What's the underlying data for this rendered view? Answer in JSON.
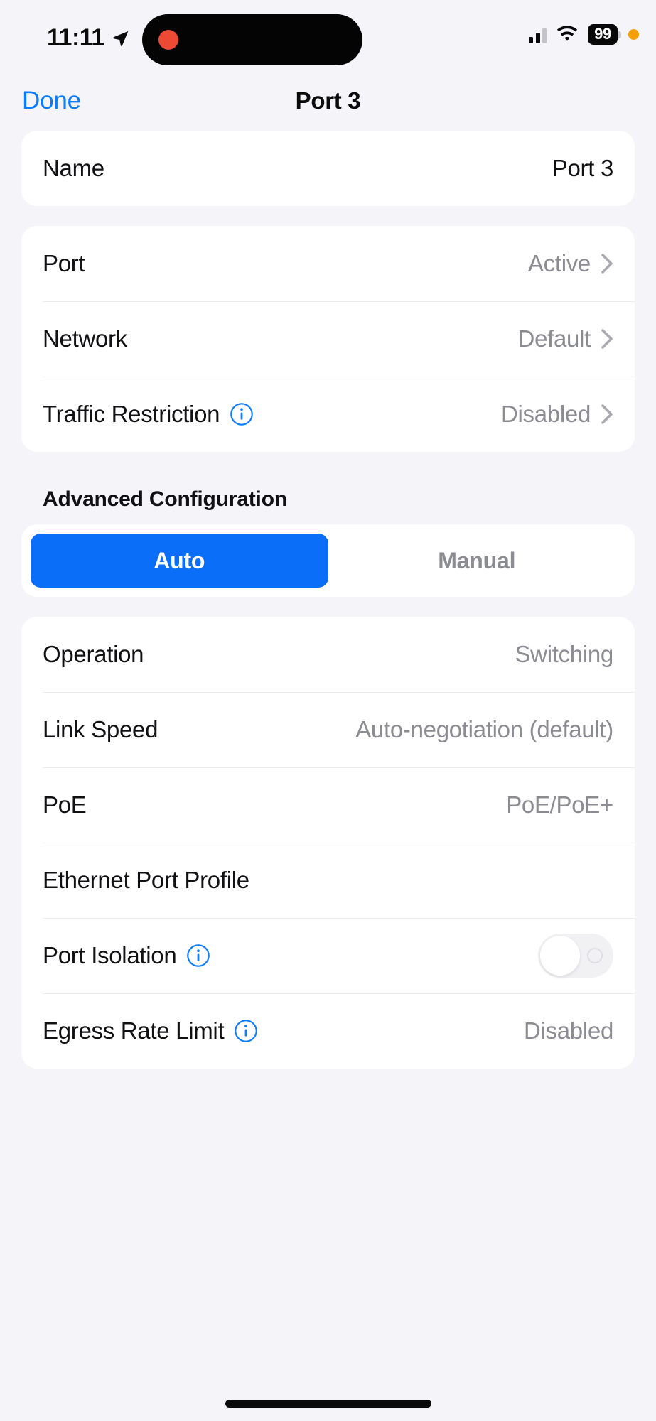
{
  "statusbar": {
    "time": "11:11",
    "location_icon": "location-arrow-icon",
    "signal_icon": "cellular-signal-icon",
    "wifi_icon": "wifi-icon",
    "battery_level": "99",
    "recording_dot": "recording-indicator",
    "privacy_dot": "privacy-indicator"
  },
  "navbar": {
    "done_label": "Done",
    "title": "Port 3"
  },
  "name_section": {
    "label": "Name",
    "value": "Port 3"
  },
  "port_section": {
    "rows": [
      {
        "label": "Port",
        "value": "Active",
        "chevron": true,
        "info": false
      },
      {
        "label": "Network",
        "value": "Default",
        "chevron": true,
        "info": false
      },
      {
        "label": "Traffic Restriction",
        "value": "Disabled",
        "chevron": true,
        "info": true
      }
    ]
  },
  "advanced": {
    "header": "Advanced Configuration",
    "segments": [
      {
        "label": "Auto",
        "selected": true
      },
      {
        "label": "Manual",
        "selected": false
      }
    ]
  },
  "advanced_rows": [
    {
      "label": "Operation",
      "value": "Switching",
      "info": false,
      "toggle": false
    },
    {
      "label": "Link Speed",
      "value": "Auto-negotiation (default)",
      "info": false,
      "toggle": false
    },
    {
      "label": "PoE",
      "value": "PoE/PoE+",
      "info": false,
      "toggle": false
    },
    {
      "label": "Ethernet Port Profile",
      "value": "",
      "info": false,
      "toggle": false
    },
    {
      "label": "Port Isolation",
      "value": "",
      "info": true,
      "toggle": true,
      "toggle_on": false
    },
    {
      "label": "Egress Rate Limit",
      "value": "Disabled",
      "info": true,
      "toggle": false
    }
  ],
  "colors": {
    "accent_blue": "#0B6EF8",
    "link_blue": "#0A7CFF",
    "page_bg": "#F5F4F8",
    "card_bg": "#FFFFFF",
    "value_gray": "#8B8B92",
    "privacy_orange": "#F5A000",
    "record_red": "#EC4A35"
  }
}
